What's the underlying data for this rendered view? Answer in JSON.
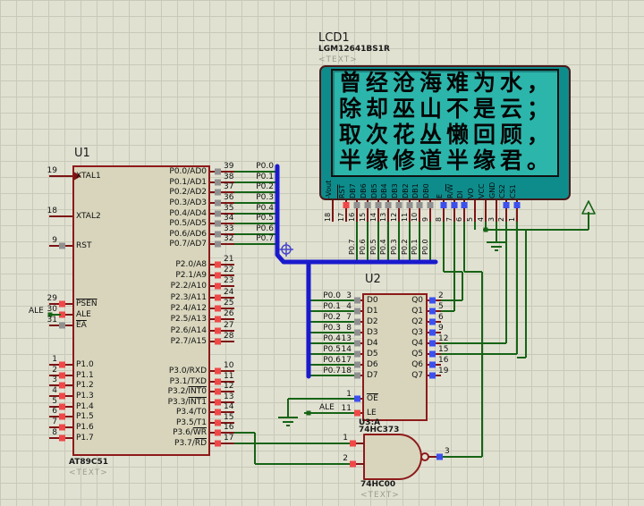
{
  "colors": {
    "wire": "#166416",
    "bus": "#1a1acd",
    "stub": "#7c1414",
    "chip_fill": "#d8d5bc",
    "chip_border": "#8e1a1a",
    "sq_red": "#f04848",
    "sq_grey": "#909090",
    "sq_blue": "#3c50ee",
    "panel": "#0e8c8c",
    "screen": "#2cb5ab",
    "text_grey": "#9c9c8c",
    "dot": "#166416"
  },
  "u1": {
    "ref": "U1",
    "part": "AT89C51",
    "placeholder": "<TEXT>",
    "left_pins": [
      {
        "num": "19",
        "label": "XTAL1",
        "sq": null,
        "clk": true
      },
      {
        "num": "18",
        "label": "XTAL2",
        "sq": null
      },
      {
        "num": "9",
        "label": "RST",
        "sq": "grey"
      },
      {
        "num": "29",
        "label": "PSEN",
        "ov": true,
        "sq": "red"
      },
      {
        "num": "30",
        "label": "ALE",
        "sq": "red",
        "wire_label": "ALE"
      },
      {
        "num": "31",
        "label": "EA",
        "ov": true,
        "sq": "grey"
      },
      {
        "num": "1",
        "label": "P1.0",
        "sq": "red"
      },
      {
        "num": "2",
        "label": "P1.1",
        "sq": "red"
      },
      {
        "num": "3",
        "label": "P1.2",
        "sq": "red"
      },
      {
        "num": "4",
        "label": "P1.3",
        "sq": "red"
      },
      {
        "num": "5",
        "label": "P1.4",
        "sq": "red"
      },
      {
        "num": "6",
        "label": "P1.5",
        "sq": "red"
      },
      {
        "num": "7",
        "label": "P1.6",
        "sq": "red"
      },
      {
        "num": "8",
        "label": "P1.7",
        "sq": "red"
      }
    ],
    "p0_pins": [
      {
        "num": "39",
        "label": "P0.0/AD0",
        "sq": "grey",
        "wire_label": "P0.0"
      },
      {
        "num": "38",
        "label": "P0.1/AD1",
        "sq": "grey",
        "wire_label": "P0.1"
      },
      {
        "num": "37",
        "label": "P0.2/AD2",
        "sq": "grey",
        "wire_label": "P0.2"
      },
      {
        "num": "36",
        "label": "P0.3/AD3",
        "sq": "grey",
        "wire_label": "P0.3"
      },
      {
        "num": "35",
        "label": "P0.4/AD4",
        "sq": "grey",
        "wire_label": "P0.4"
      },
      {
        "num": "34",
        "label": "P0.5/AD5",
        "sq": "grey",
        "wire_label": "P0.5"
      },
      {
        "num": "33",
        "label": "P0.6/AD6",
        "sq": "grey",
        "wire_label": "P0.6"
      },
      {
        "num": "32",
        "label": "P0.7/AD7",
        "sq": "grey",
        "wire_label": "P0.7"
      }
    ],
    "p2_pins": [
      {
        "num": "21",
        "label": "P2.0/A8",
        "sq": "red"
      },
      {
        "num": "22",
        "label": "P2.1/A9",
        "sq": "red"
      },
      {
        "num": "23",
        "label": "P2.2/A10",
        "sq": "red"
      },
      {
        "num": "24",
        "label": "P2.3/A11",
        "sq": "red"
      },
      {
        "num": "25",
        "label": "P2.4/A12",
        "sq": "red"
      },
      {
        "num": "26",
        "label": "P2.5/A13",
        "sq": "red"
      },
      {
        "num": "27",
        "label": "P2.6/A14",
        "sq": "red"
      },
      {
        "num": "28",
        "label": "P2.7/A15",
        "sq": "red"
      }
    ],
    "p3_pins": [
      {
        "num": "10",
        "pre": "P3.0/RXD",
        "ovpart": "",
        "sq": "red"
      },
      {
        "num": "11",
        "pre": "P3.1/TXD",
        "ovpart": "",
        "sq": "red"
      },
      {
        "num": "12",
        "pre": "P3.2/",
        "ovpart": "INT0",
        "sq": "red"
      },
      {
        "num": "13",
        "pre": "P3.3/",
        "ovpart": "INT1",
        "sq": "red"
      },
      {
        "num": "14",
        "pre": "P3.4/T0",
        "ovpart": "",
        "sq": "red"
      },
      {
        "num": "15",
        "pre": "P3.5/T1",
        "ovpart": "",
        "sq": "red"
      },
      {
        "num": "16",
        "pre": "P3.6/",
        "ovpart": "WR",
        "sq": "red"
      },
      {
        "num": "17",
        "pre": "P3.7/",
        "ovpart": "RD",
        "sq": "red"
      }
    ]
  },
  "lcd": {
    "ref": "LCD1",
    "part": "LGM12641BS1R",
    "placeholder": "<TEXT>",
    "screen_lines": [
      "曾经沧海难为水，",
      "除却巫山不是云；",
      "取次花丛懒回顾，",
      "半缘修道半缘君。"
    ],
    "pins": [
      {
        "num": "18",
        "pre": "-Vout",
        "ovpart": "",
        "sq": null
      },
      {
        "num": "17",
        "pre": "",
        "ovpart": "RST",
        "sq": "red"
      },
      {
        "num": "16",
        "pre": "DB7",
        "ovpart": "",
        "sq": "grey",
        "wire_label": "P0.7"
      },
      {
        "num": "15",
        "pre": "DB6",
        "ovpart": "",
        "sq": "grey",
        "wire_label": "P0.6"
      },
      {
        "num": "14",
        "pre": "DB5",
        "ovpart": "",
        "sq": "grey",
        "wire_label": "P0.5"
      },
      {
        "num": "13",
        "pre": "DB4",
        "ovpart": "",
        "sq": "grey",
        "wire_label": "P0.4"
      },
      {
        "num": "12",
        "pre": "DB3",
        "ovpart": "",
        "sq": "grey",
        "wire_label": "P0.3"
      },
      {
        "num": "11",
        "pre": "DB2",
        "ovpart": "",
        "sq": "grey",
        "wire_label": "P0.2"
      },
      {
        "num": "10",
        "pre": "DB1",
        "ovpart": "",
        "sq": "grey",
        "wire_label": "P0.1"
      },
      {
        "num": "9",
        "pre": "DB0",
        "ovpart": "",
        "sq": "grey",
        "wire_label": "P0.0"
      },
      {
        "num": "8",
        "pre": "E",
        "ovpart": "",
        "sq": "blue"
      },
      {
        "num": "7",
        "pre": "R/",
        "ovpart": "W",
        "sq": "blue"
      },
      {
        "num": "6",
        "pre": "DI",
        "ovpart": "",
        "sq": "blue"
      },
      {
        "num": "5",
        "pre": "VO",
        "ovpart": "",
        "sq": null
      },
      {
        "num": "4",
        "pre": "VCC",
        "ovpart": "",
        "sq": null
      },
      {
        "num": "3",
        "pre": "GND",
        "ovpart": "",
        "sq": null
      },
      {
        "num": "2",
        "pre": "CS2",
        "ovpart": "",
        "sq": "blue"
      },
      {
        "num": "1",
        "pre": "CS1",
        "ovpart": "",
        "sq": "blue"
      }
    ]
  },
  "u2": {
    "ref": "U2",
    "gate_ref": "U3:A",
    "part": "74HC373",
    "left_pins": [
      {
        "num": "3",
        "label": "D0",
        "sq": "grey",
        "wire_label": "P0.0"
      },
      {
        "num": "4",
        "label": "D1",
        "sq": "grey",
        "wire_label": "P0.1"
      },
      {
        "num": "7",
        "label": "D2",
        "sq": "grey",
        "wire_label": "P0.2"
      },
      {
        "num": "8",
        "label": "D3",
        "sq": "grey",
        "wire_label": "P0.3"
      },
      {
        "num": "13",
        "label": "D4",
        "sq": "grey",
        "wire_label": "P0.4"
      },
      {
        "num": "14",
        "label": "D5",
        "sq": "grey",
        "wire_label": "P0.5"
      },
      {
        "num": "17",
        "label": "D6",
        "sq": "grey",
        "wire_label": "P0.6"
      },
      {
        "num": "18",
        "label": "D7",
        "sq": "grey",
        "wire_label": "P0.7"
      }
    ],
    "oe_pin": {
      "num": "1",
      "label": "OE",
      "ov": true,
      "sq": "blue"
    },
    "le_pin": {
      "num": "11",
      "label": "LE",
      "sq": "red",
      "wire_label": "ALE"
    },
    "right_pins": [
      {
        "num": "2",
        "label": "Q0",
        "sq": "blue"
      },
      {
        "num": "5",
        "label": "Q1",
        "sq": "blue"
      },
      {
        "num": "6",
        "label": "Q2",
        "sq": "blue"
      },
      {
        "num": "9",
        "label": "Q3",
        "sq": "blue"
      },
      {
        "num": "12",
        "label": "Q4",
        "sq": "blue"
      },
      {
        "num": "15",
        "label": "Q5",
        "sq": "blue"
      },
      {
        "num": "16",
        "label": "Q6",
        "sq": "blue"
      },
      {
        "num": "19",
        "label": "Q7",
        "sq": "blue"
      }
    ]
  },
  "nand": {
    "part": "74HC00",
    "placeholder": "<TEXT>",
    "in1": {
      "num": "1",
      "sq": "red"
    },
    "in2": {
      "num": "2",
      "sq": "red"
    },
    "out": {
      "num": "3",
      "sq": "blue"
    }
  }
}
